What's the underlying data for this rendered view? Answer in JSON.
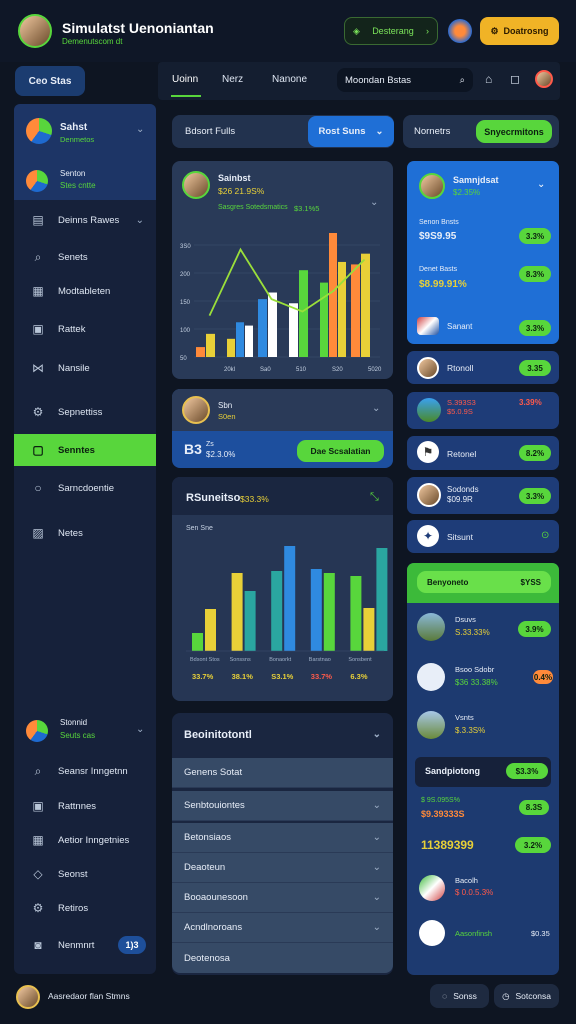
{
  "header": {
    "title": "Simulatst Uenoniantan",
    "subtitle": "Demenutscom dt",
    "chip_label": "Desterang",
    "action_button": "Doatrosng"
  },
  "topbar": {
    "left_button": "Ceo Stas",
    "tabs": [
      "Uoinn",
      "Nerz",
      "Nanone"
    ],
    "search_placeholder": "Moondan Bstas"
  },
  "sidebar": {
    "profile": {
      "name": "Sahst",
      "sub": "Denmetos"
    },
    "profile2": {
      "name": "Senton",
      "sub": "Stes cntte"
    },
    "items": [
      {
        "label": "Deinns Rawes",
        "icon": "grid-icon"
      },
      {
        "label": "Senets",
        "icon": "search-icon"
      },
      {
        "label": "Modtableten",
        "icon": "calendar-icon"
      },
      {
        "label": "Rattek",
        "icon": "table-icon"
      },
      {
        "label": "Nansile",
        "icon": "share-icon"
      },
      {
        "label": "Sepnettiss",
        "icon": "settings-icon"
      },
      {
        "label": "Senntes",
        "icon": "layout-icon"
      },
      {
        "label": "Sarncdoentie",
        "icon": "search-icon"
      },
      {
        "label": "Netes",
        "icon": "film-icon"
      }
    ],
    "bottom_profile": {
      "name": "Stonnid",
      "sub": "Seuts cas"
    },
    "bottom_items": [
      {
        "label": "Seansr Inngetnn",
        "icon": "search-icon"
      },
      {
        "label": "Rattnnes",
        "icon": "table-icon"
      },
      {
        "label": "Aetior Inngetnies",
        "icon": "calendar-icon"
      },
      {
        "label": "Seonst",
        "icon": "tag-icon"
      },
      {
        "label": "Retiros",
        "icon": "settings-icon"
      },
      {
        "label": "Nenmnrt",
        "icon": "chat-icon",
        "badge": "1)3"
      }
    ]
  },
  "controls": {
    "left_select": "Bdsort Fulls",
    "blue_select": "Rost Suns",
    "right_label": "Nornetrs",
    "green_button": "Snyecrmitons"
  },
  "chart1": {
    "name": "Sainbst",
    "value_line": "$26 21.9S%",
    "sub_line": "Sasgres Sotedsmatics",
    "sub_value": "$3.1%5",
    "y_ticks": [
      "3S0",
      "200",
      "150",
      "100",
      "50"
    ],
    "x_ticks": [
      "20kl",
      "Sa0",
      "510",
      "S20",
      "5020"
    ]
  },
  "chart_data": [
    {
      "type": "bar",
      "title": "",
      "bar_groups": [
        {
          "values": [
            12,
            28
          ]
        },
        {
          "values": [
            22,
            42,
            38
          ]
        },
        {
          "values": [
            70,
            78
          ]
        },
        {
          "values": [
            65,
            105
          ]
        },
        {
          "values": [
            90,
            150,
            115
          ]
        },
        {
          "values": [
            112,
            125
          ]
        }
      ],
      "line_values": [
        50,
        130,
        70,
        55,
        80,
        118
      ],
      "ylim": [
        0,
        150
      ]
    },
    {
      "type": "bar",
      "title": "",
      "categories": [
        "Bdsont Stos",
        "Sonssns",
        "Bonaorkt",
        "Barstnao",
        "Sonsbent"
      ],
      "series": [
        {
          "values": [
            18,
            0
          ]
        },
        {
          "values": [
            42,
            78
          ]
        },
        {
          "values": [
            58,
            82
          ]
        },
        {
          "values": [
            80,
            105
          ]
        },
        {
          "values": [
            0,
            0
          ]
        }
      ],
      "groups": [
        [
          18,
          42
        ],
        [
          78,
          60
        ],
        [
          80,
          105
        ],
        [
          82,
          78
        ],
        [
          75,
          43,
          103
        ]
      ],
      "bottom_labels": [
        "33.7%",
        "38.1%",
        "S3.1%",
        "33.7%",
        "6.3%"
      ]
    }
  ],
  "mid_card": {
    "name": "Sbn",
    "sub": "S0en",
    "value": "$2.3.0%",
    "prefix": "B3",
    "unit": "Zs",
    "button": "Dae Scsalatian"
  },
  "chart2": {
    "title": "RSuneitso",
    "value": "$33.3%",
    "subtitle": "Sen Sne"
  },
  "accordion": {
    "header": "Beoinitotontl",
    "items": [
      "Genens Sotat",
      "Senbtouiontes",
      "Betonsiaos",
      "Deaoteun",
      "Booaounesoon",
      "Acndlnoroans",
      "Deotenosa"
    ]
  },
  "right_col": {
    "top_card": {
      "name": "Samnjdsat",
      "sub": "$2.35%",
      "line1_label": "Senon Bnsts",
      "line1_value": "$9S9.95",
      "line1_badge": "3.3%",
      "line2_label": "Denet Basts",
      "line2_value": "$8.99.91%",
      "line2_badge": "8.3%",
      "line3_label": "Sanant",
      "line3_badge": "3.3%"
    },
    "small_cards": [
      {
        "label": "Rtonoll",
        "badge": "3.35",
        "color": "#1e4f9a"
      },
      {
        "label": "S.393S3\n$5.0.9S",
        "badge": "3.39%",
        "color": "#1e4f9a",
        "red": true
      },
      {
        "label": "Retonel",
        "badge": "8.2%",
        "color": "#1e4f9a"
      },
      {
        "label": "Sodonds\n$09.9R",
        "badge": "3.3%",
        "color": "#1e4f9a"
      },
      {
        "label": "Sitsunt",
        "badge": "",
        "color": "#1e4f9a"
      }
    ],
    "bottom_panel": {
      "header": "Benyoneto",
      "header_value": "$YSS",
      "items": [
        {
          "name": "Dsuvs",
          "value": "S.33.33%",
          "badge": "3.9%"
        },
        {
          "name": "Bsoo Sdobr",
          "value": "$36 33.38%",
          "badge": "0.4%"
        },
        {
          "name": "Vsnts",
          "value": "$.3.3S%",
          "badge": ""
        }
      ],
      "sub_header": "Sandpiotong",
      "sub_header_value": "$3.3%",
      "stat_label": "$ 9S.095S%",
      "stat_value": "$9.39333S",
      "stat_badge": "8.3S",
      "big_value": "11389399",
      "big_badge": "3.2%",
      "list": [
        {
          "name": "Bacolh",
          "value": "$ 0.0.5.3%"
        },
        {
          "name": "Aasonfinsh",
          "value": "$0.35"
        }
      ]
    }
  },
  "footer": {
    "user": "Aasredaor flan Stmns",
    "btn1": "Sonss",
    "btn2": "Sotconsa"
  }
}
